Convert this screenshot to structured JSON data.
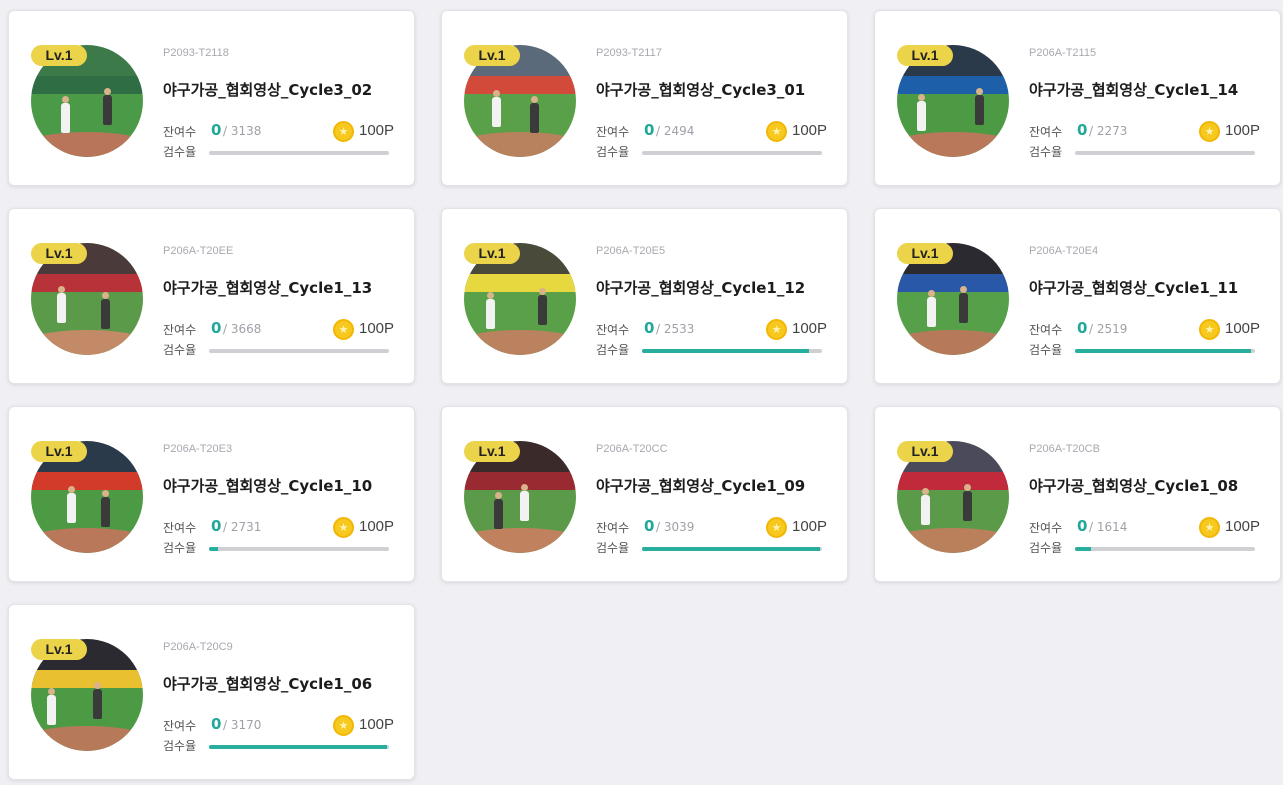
{
  "labels": {
    "remain": "잔여수",
    "rate": "검수율",
    "remain_value": "0",
    "coin_glyph": "★"
  },
  "colors": {
    "accent": "#27ae9c",
    "badge": "#ecd44a",
    "coin": "#f7c81e"
  },
  "cards": [
    {
      "level": "Lv.1",
      "code": "P2093-T2118",
      "title": "야구가공_협회영상_Cycle3_02",
      "total": "/ 3138",
      "points": "100P",
      "progress": 0.0,
      "scene": {
        "sky": "#3c7a4a",
        "board": "#2f6e45",
        "field": "#4a9a48",
        "dirt": "#b8755a"
      }
    },
    {
      "level": "Lv.1",
      "code": "P2093-T2117",
      "title": "야구가공_협회영상_Cycle3_01",
      "total": "/ 2494",
      "points": "100P",
      "progress": 0.0,
      "scene": {
        "sky": "#5a6a7a",
        "board": "#d24a3a",
        "field": "#5aa048",
        "dirt": "#b9825f"
      }
    },
    {
      "level": "Lv.1",
      "code": "P206A-T2115",
      "title": "야구가공_협회영상_Cycle1_14",
      "total": "/ 2273",
      "points": "100P",
      "progress": 0.0,
      "scene": {
        "sky": "#2a3a4a",
        "board": "#1d5fa8",
        "field": "#4c9a44",
        "dirt": "#b9785a"
      }
    },
    {
      "level": "Lv.1",
      "code": "P206A-T20EE",
      "title": "야구가공_협회영상_Cycle1_13",
      "total": "/ 3668",
      "points": "100P",
      "progress": 0.0,
      "scene": {
        "sky": "#4a3a3a",
        "board": "#b8323a",
        "field": "#5a9a48",
        "dirt": "#c28a66"
      }
    },
    {
      "level": "Lv.1",
      "code": "P206A-T20E5",
      "title": "야구가공_협회영상_Cycle1_12",
      "total": "/ 2533",
      "points": "100P",
      "progress": 0.93,
      "scene": {
        "sky": "#4a4a3a",
        "board": "#e8d840",
        "field": "#5aa048",
        "dirt": "#ba825e"
      }
    },
    {
      "level": "Lv.1",
      "code": "P206A-T20E4",
      "title": "야구가공_협회영상_Cycle1_11",
      "total": "/ 2519",
      "points": "100P",
      "progress": 0.98,
      "scene": {
        "sky": "#2a2a30",
        "board": "#2a58a8",
        "field": "#55a048",
        "dirt": "#b67a5a"
      }
    },
    {
      "level": "Lv.1",
      "code": "P206A-T20E3",
      "title": "야구가공_협회영상_Cycle1_10",
      "total": "/ 2731",
      "points": "100P",
      "progress": 0.05,
      "scene": {
        "sky": "#2a3a4a",
        "board": "#d23a2a",
        "field": "#4c9a44",
        "dirt": "#b9785a"
      }
    },
    {
      "level": "Lv.1",
      "code": "P206A-T20CC",
      "title": "야구가공_협회영상_Cycle1_09",
      "total": "/ 3039",
      "points": "100P",
      "progress": 0.99,
      "scene": {
        "sky": "#3a2a2a",
        "board": "#9a2a32",
        "field": "#5a9a48",
        "dirt": "#c0825e"
      }
    },
    {
      "level": "Lv.1",
      "code": "P206A-T20CB",
      "title": "야구가공_협회영상_Cycle1_08",
      "total": "/ 1614",
      "points": "100P",
      "progress": 0.09,
      "scene": {
        "sky": "#4a4a5a",
        "board": "#c02a3a",
        "field": "#5a9a48",
        "dirt": "#ba805c"
      }
    },
    {
      "level": "Lv.1",
      "code": "P206A-T20C9",
      "title": "야구가공_협회영상_Cycle1_06",
      "total": "/ 3170",
      "points": "100P",
      "progress": 0.99,
      "scene": {
        "sky": "#2a2a30",
        "board": "#e8c030",
        "field": "#4c9a44",
        "dirt": "#b67a5a"
      }
    }
  ]
}
